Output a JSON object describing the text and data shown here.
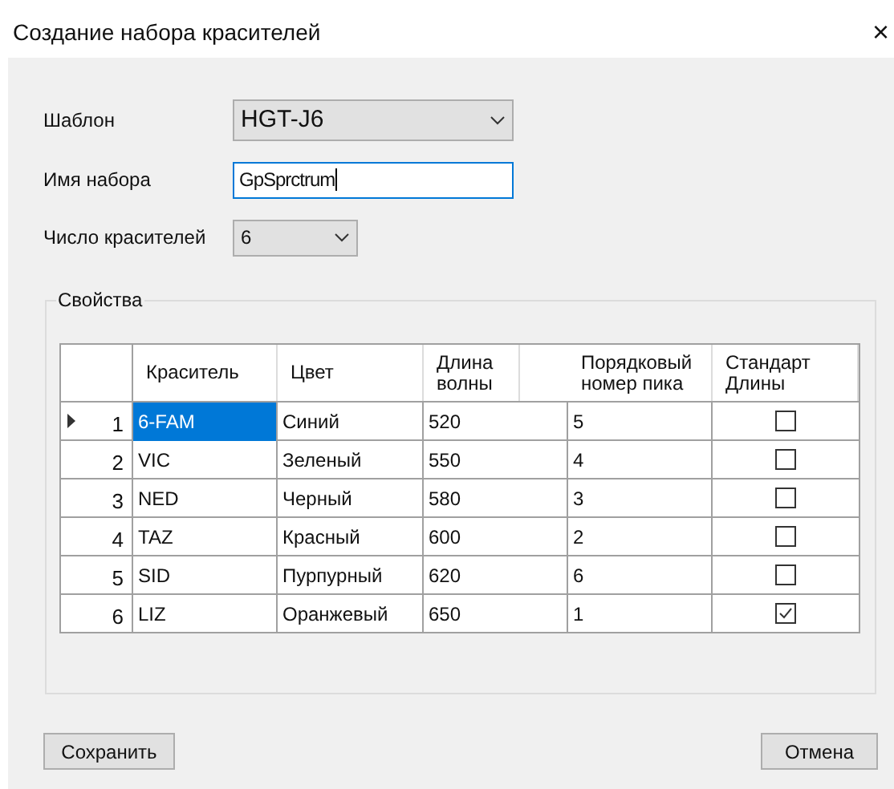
{
  "window": {
    "title": "Создание набора красителей",
    "close": "×"
  },
  "template": {
    "label": "Шаблон",
    "value": "HGT-J6"
  },
  "set_name": {
    "label": "Имя набора",
    "value": "GpSprctrum"
  },
  "dye_count": {
    "label": "Число красителей",
    "value": "6"
  },
  "properties": {
    "title": "Свойства",
    "columns": [
      "Краситель",
      "Цвет",
      "Длина волны",
      "Порядковый номер пика",
      "Стандарт Длины"
    ],
    "rows": [
      {
        "number": "1",
        "dye": "6-FAM",
        "color_name": "Синий",
        "wavelength": "520",
        "peak": "5",
        "checked": false,
        "selected": true
      },
      {
        "number": "2",
        "dye": "VIC",
        "color_name": "Зеленый",
        "wavelength": "550",
        "peak": "4",
        "checked": false,
        "selected": false
      },
      {
        "number": "3",
        "dye": "NED",
        "color_name": "Черный",
        "wavelength": "580",
        "peak": "3",
        "checked": false,
        "selected": false
      },
      {
        "number": "4",
        "dye": "TAZ",
        "color_name": "Красный",
        "wavelength": "600",
        "peak": "2",
        "checked": false,
        "selected": false
      },
      {
        "number": "5",
        "dye": "SID",
        "color_name": "Пурпурный",
        "wavelength": "620",
        "peak": "6",
        "checked": false,
        "selected": false
      },
      {
        "number": "6",
        "dye": "LIZ",
        "color_name": "Оранжевый",
        "wavelength": "650",
        "peak": "1",
        "checked": true,
        "selected": false
      }
    ]
  },
  "buttons": {
    "save": "Сохранить",
    "cancel": "Отмена"
  }
}
